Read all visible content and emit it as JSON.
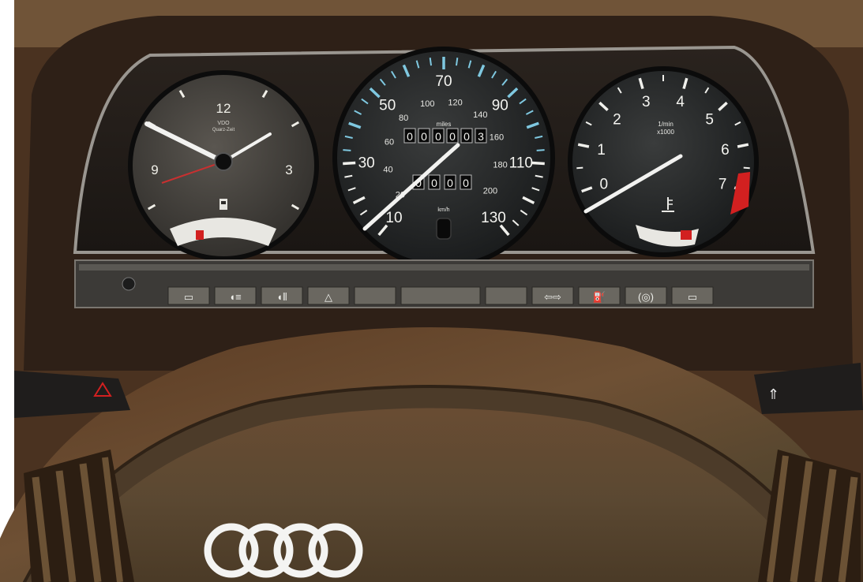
{
  "clock": {
    "numerals": [
      "12",
      "3",
      "9"
    ],
    "brand": "VDO",
    "subtitle": "Quarz-Zeit"
  },
  "speedometer": {
    "mph_labels": [
      "10",
      "30",
      "50",
      "70",
      "90",
      "110",
      "130"
    ],
    "kmh_labels": [
      "20",
      "40",
      "60",
      "80",
      "100",
      "120",
      "140",
      "160",
      "180",
      "200"
    ],
    "odometer_unit": "miles",
    "odometer_digits": [
      "0",
      "0",
      "0",
      "0",
      "0",
      "3"
    ],
    "trip_digits": [
      "0",
      "0",
      "0",
      "0"
    ],
    "small_unit": "km/h"
  },
  "tachometer": {
    "numerals": [
      "0",
      "1",
      "2",
      "3",
      "4",
      "5",
      "6",
      "7"
    ],
    "unit_line1": "1/min",
    "unit_line2": "x1000"
  },
  "warning_lights": [
    "rear-defrost-icon",
    "headlight-icon",
    "fog-light-icon",
    "hazard-icon",
    "blank",
    "blank-wide",
    "blank",
    "turn-signal-icon",
    "oil-can-icon",
    "brake-icon",
    "battery-icon"
  ],
  "colors": {
    "wood_dark": "#3b2415",
    "wood_mid": "#6a4a2e",
    "dial_face": "#1c1f21",
    "needle": "#f2f2f0",
    "redline": "#d22020",
    "cyan_ticks": "#7fc8e0",
    "emblem": "#f4f4f2"
  }
}
